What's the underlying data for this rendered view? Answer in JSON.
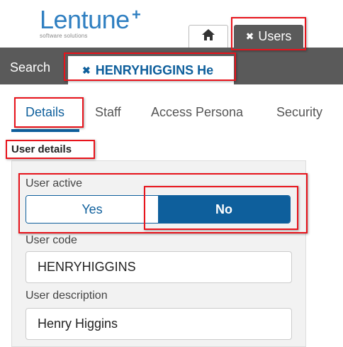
{
  "logo": {
    "wordmark": "Lentune",
    "plus": "+",
    "tagline": "software solutions"
  },
  "tabs": {
    "home_icon": "home-icon",
    "users": {
      "close_glyph": "✖",
      "label": "Users"
    }
  },
  "topbar": {
    "search_label": "Search",
    "record_tab": {
      "close_glyph": "✖",
      "label": "HENRYHIGGINS He"
    }
  },
  "subtabs": [
    {
      "label": "Details",
      "active": true
    },
    {
      "label": "Staff"
    },
    {
      "label": "Access Persona"
    },
    {
      "label": "Security"
    }
  ],
  "section_title": "User details",
  "form": {
    "user_active": {
      "label": "User active",
      "yes": "Yes",
      "no": "No",
      "selected": "No"
    },
    "user_code": {
      "label": "User code",
      "value": "HENRYHIGGINS"
    },
    "user_description": {
      "label": "User description",
      "value": "Henry Higgins"
    }
  },
  "colors": {
    "brand": "#2f7fc1",
    "accent": "#0e5f9c",
    "highlight": "#e8141c",
    "bar": "#5a5a5a"
  }
}
